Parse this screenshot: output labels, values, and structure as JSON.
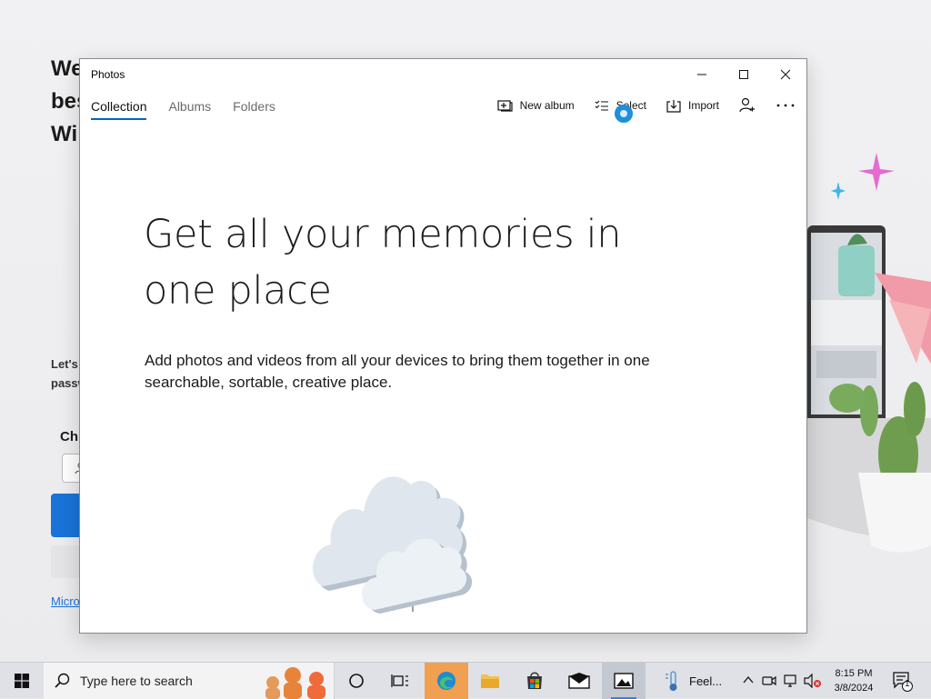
{
  "background_app": {
    "heading": "We\nbes\nWi",
    "body": "Let's\npassw",
    "subheading": "Ch",
    "link": "Micro"
  },
  "window": {
    "title": "Photos",
    "nav_tabs": [
      {
        "label": "Collection",
        "active": true
      },
      {
        "label": "Albums",
        "active": false
      },
      {
        "label": "Folders",
        "active": false
      }
    ],
    "toolbar": {
      "new_album": "New album",
      "select": "Select",
      "import": "Import"
    },
    "hero": {
      "title": "Get all your memories in one place",
      "body": "Add photos and videos from all your devices to bring them together in one searchable, sortable, creative place."
    }
  },
  "taskbar": {
    "search_placeholder": "Type here to search",
    "weather_text": "Feel...",
    "time": "8:15 PM",
    "date": "3/8/2024",
    "notification_count": "1",
    "active_app": "Photos"
  },
  "colors": {
    "accent": "#0067c0",
    "cursor": "#1e8fd8",
    "taskbar": "#dfe1e6"
  }
}
